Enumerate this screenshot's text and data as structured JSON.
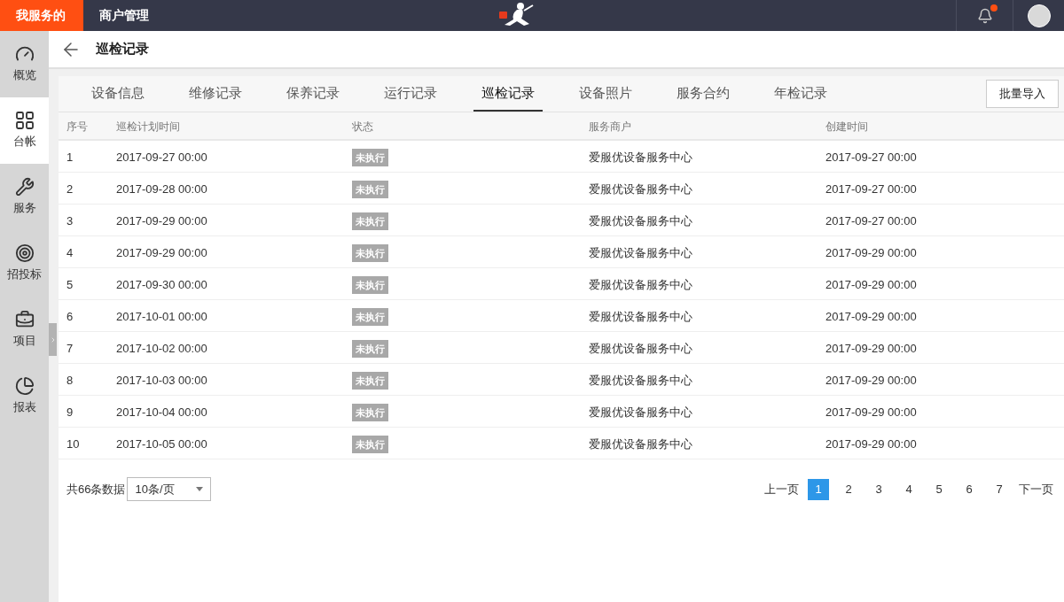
{
  "top_nav": [
    {
      "label": "我服务的",
      "selected": true
    },
    {
      "label": "商户管理",
      "selected": false
    }
  ],
  "notifications": {
    "unread": true
  },
  "sidebar": {
    "items": [
      {
        "label": "概览",
        "selected": false
      },
      {
        "label": "台帐",
        "selected": true
      },
      {
        "label": "服务",
        "selected": false
      },
      {
        "label": "招投标",
        "selected": false
      },
      {
        "label": "项目",
        "selected": false
      },
      {
        "label": "报表",
        "selected": false
      }
    ]
  },
  "page": {
    "title": "巡检记录"
  },
  "tabs": [
    {
      "label": "设备信息",
      "selected": false
    },
    {
      "label": "维修记录",
      "selected": false
    },
    {
      "label": "保养记录",
      "selected": false
    },
    {
      "label": "运行记录",
      "selected": false
    },
    {
      "label": "巡检记录",
      "selected": true
    },
    {
      "label": "设备照片",
      "selected": false
    },
    {
      "label": "服务合约",
      "selected": false
    },
    {
      "label": "年检记录",
      "selected": false
    }
  ],
  "import_button": "批量导入",
  "table": {
    "columns": [
      "序号",
      "巡检计划时间",
      "状态",
      "服务商户",
      "创建时间"
    ],
    "rows": [
      [
        "1",
        "2017-09-27 00:00",
        "未执行",
        "爱服优设备服务中心",
        "2017-09-27 00:00"
      ],
      [
        "2",
        "2017-09-28 00:00",
        "未执行",
        "爱服优设备服务中心",
        "2017-09-27 00:00"
      ],
      [
        "3",
        "2017-09-29 00:00",
        "未执行",
        "爱服优设备服务中心",
        "2017-09-27 00:00"
      ],
      [
        "4",
        "2017-09-29 00:00",
        "未执行",
        "爱服优设备服务中心",
        "2017-09-29 00:00"
      ],
      [
        "5",
        "2017-09-30 00:00",
        "未执行",
        "爱服优设备服务中心",
        "2017-09-29 00:00"
      ],
      [
        "6",
        "2017-10-01 00:00",
        "未执行",
        "爱服优设备服务中心",
        "2017-09-29 00:00"
      ],
      [
        "7",
        "2017-10-02 00:00",
        "未执行",
        "爱服优设备服务中心",
        "2017-09-29 00:00"
      ],
      [
        "8",
        "2017-10-03 00:00",
        "未执行",
        "爱服优设备服务中心",
        "2017-09-29 00:00"
      ],
      [
        "9",
        "2017-10-04 00:00",
        "未执行",
        "爱服优设备服务中心",
        "2017-09-29 00:00"
      ],
      [
        "10",
        "2017-10-05 00:00",
        "未执行",
        "爱服优设备服务中心",
        "2017-09-29 00:00"
      ]
    ]
  },
  "footer": {
    "total": "共66条数据",
    "page_size": "10条/页"
  },
  "pagination": {
    "prev": "上一页",
    "next": "下一页",
    "pages": [
      {
        "label": "1",
        "selected": true
      },
      {
        "label": "2",
        "selected": false
      },
      {
        "label": "3",
        "selected": false
      },
      {
        "label": "4",
        "selected": false
      },
      {
        "label": "5",
        "selected": false
      },
      {
        "label": "6",
        "selected": false
      },
      {
        "label": "7",
        "selected": false
      }
    ]
  }
}
